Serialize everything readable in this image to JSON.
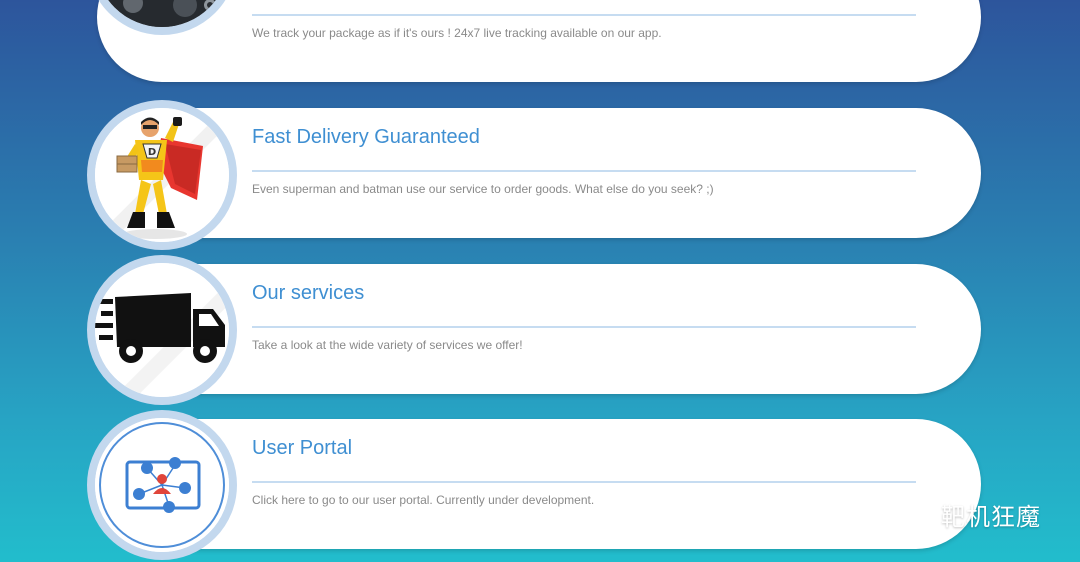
{
  "cards": [
    {
      "title": "",
      "description": "We track your package as if it's ours ! 24x7 live tracking available on our app.",
      "icon": "tracking-camera-icon"
    },
    {
      "title": "Fast Delivery Guaranteed",
      "description": "Even superman and batman use our service to order goods. What else do you seek? ;)",
      "icon": "superhero-delivery-icon",
      "icon_badge": "D"
    },
    {
      "title": "Our services",
      "description": "Take a look at the wide variety of services we offer!",
      "icon": "delivery-truck-icon"
    },
    {
      "title": "User Portal",
      "description": "Click here to go to our user portal. Currently under development.",
      "icon": "user-network-icon"
    }
  ],
  "watermark": {
    "text": "靶机狂魔",
    "icon": "wechat-icon"
  },
  "colors": {
    "background_top": "#2d559c",
    "background_bottom": "#22bdcc",
    "card": "#ffffff",
    "title": "#3f8fd2",
    "rule": "#c6dcf1",
    "description": "#8a8a8a",
    "avatar_ring": "#c3d8ee"
  }
}
